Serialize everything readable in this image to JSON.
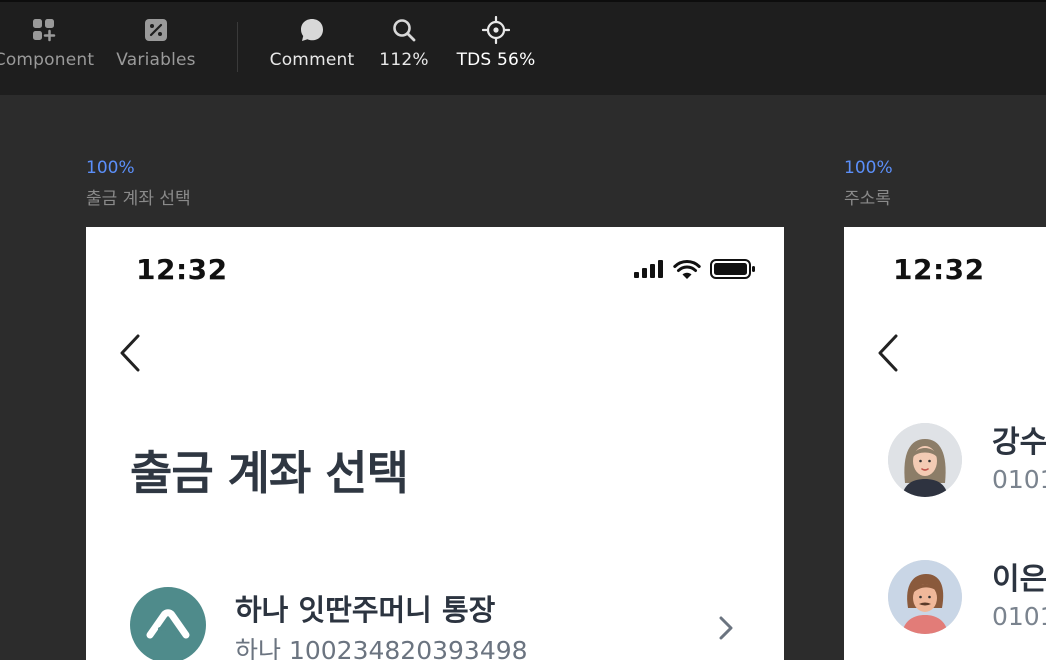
{
  "toolbar": {
    "tools": [
      {
        "label": "Component",
        "icon": "component-icon"
      },
      {
        "label": "Variables",
        "icon": "variables-icon"
      },
      {
        "label": "Comment",
        "icon": "comment-icon"
      },
      {
        "label": "112%",
        "icon": "zoom-icon"
      },
      {
        "label": "TDS 56%",
        "icon": "target-icon"
      }
    ]
  },
  "frames": [
    {
      "zoom": "100%",
      "name": "출금 계좌 선택",
      "status_time": "12:32",
      "title": "출금 계좌 선택",
      "account": {
        "name": "하나 잇딴주머니 통장",
        "number": "하나 100234820393498"
      }
    },
    {
      "zoom": "100%",
      "name": "주소록",
      "status_time": "12:32",
      "contacts": [
        {
          "name": "강수",
          "number": "0101"
        },
        {
          "name": "이은",
          "number": "0101"
        }
      ]
    }
  ],
  "colors": {
    "canvas": "#2c2c2c",
    "toolbar": "#1e1e1e",
    "accent": "#5b8ff9",
    "bank_avatar": "#4f8b8b"
  }
}
